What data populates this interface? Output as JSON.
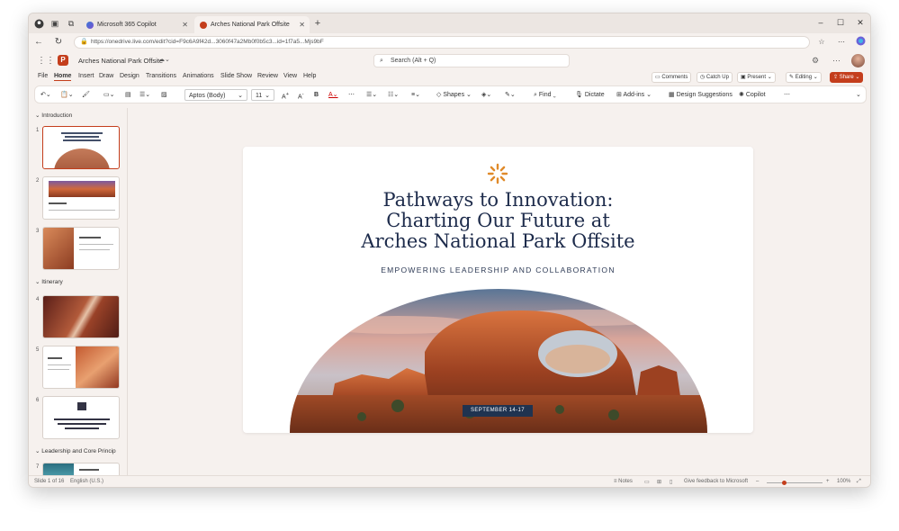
{
  "browser": {
    "tabs": [
      {
        "title": "Microsoft 365 Copilot",
        "active": false
      },
      {
        "title": "Arches National Park Offsite",
        "active": true
      }
    ],
    "url": "https://onedrive.live.com/edit?cid=F9c6A9f42d...3060f47a2Mb0f0b5c3...id=1f7a5...Mjs9bF",
    "new_tab_label": "+"
  },
  "app": {
    "doc_title": "Arches National Park Offsite",
    "search_placeholder": "Search (Alt + Q)",
    "menu": [
      "File",
      "Home",
      "Insert",
      "Draw",
      "Design",
      "Transitions",
      "Animations",
      "Slide Show",
      "Review",
      "View",
      "Help"
    ],
    "active_menu": "Home",
    "right_actions": {
      "comments": "Comments",
      "catch_up": "Catch Up",
      "present": "Present",
      "editing": "Editing",
      "share": "Share"
    }
  },
  "ribbon": {
    "font_name": "Aptos (Body)",
    "font_size": "11",
    "shapes": "Shapes",
    "find": "Find",
    "dictate": "Dictate",
    "addins": "Add-ins",
    "designer": "Design Suggestions",
    "copilot": "Copilot"
  },
  "sections": [
    {
      "name": "Introduction"
    },
    {
      "name": "Itinerary"
    },
    {
      "name": "Leadership and Core Princip"
    }
  ],
  "slide_numbers": [
    "1",
    "2",
    "3",
    "4",
    "5",
    "6",
    "7"
  ],
  "slide": {
    "title_line1": "Pathways to Innovation:",
    "title_line2": "Charting Our Future at",
    "title_line3": "Arches National Park Offsite",
    "subtitle": "EMPOWERING LEADERSHIP AND COLLABORATION",
    "date": "SEPTEMBER 14-17"
  },
  "status": {
    "slide_of": "Slide 1 of 16",
    "language": "English (U.S.)",
    "notes": "Notes",
    "feedback": "Give feedback to Microsoft",
    "zoom": "100%"
  },
  "colors": {
    "accent": "#c43e1c",
    "title": "#1d2b4b",
    "badge": "#1f3350"
  }
}
